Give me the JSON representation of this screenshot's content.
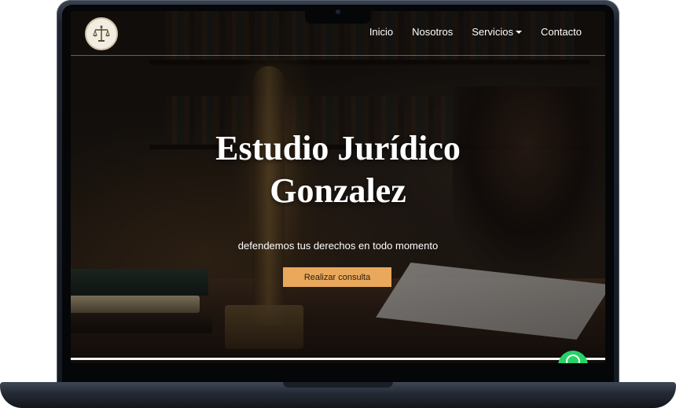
{
  "navbar": {
    "logo_icon": "scales-of-justice-icon",
    "links": [
      {
        "label": "Inicio"
      },
      {
        "label": "Nosotros"
      },
      {
        "label": "Servicios",
        "has_dropdown": true
      },
      {
        "label": "Contacto"
      }
    ]
  },
  "hero": {
    "title_line1": "Estudio Jurídico",
    "title_line2": "Gonzalez",
    "subtitle": "defendemos tus derechos en todo momento",
    "cta_label": "Realizar consulta"
  },
  "floating": {
    "icon": "whatsapp-icon"
  },
  "colors": {
    "accent": "#e9a85b",
    "whatsapp": "#25d366",
    "laptop": "#1f2530"
  }
}
